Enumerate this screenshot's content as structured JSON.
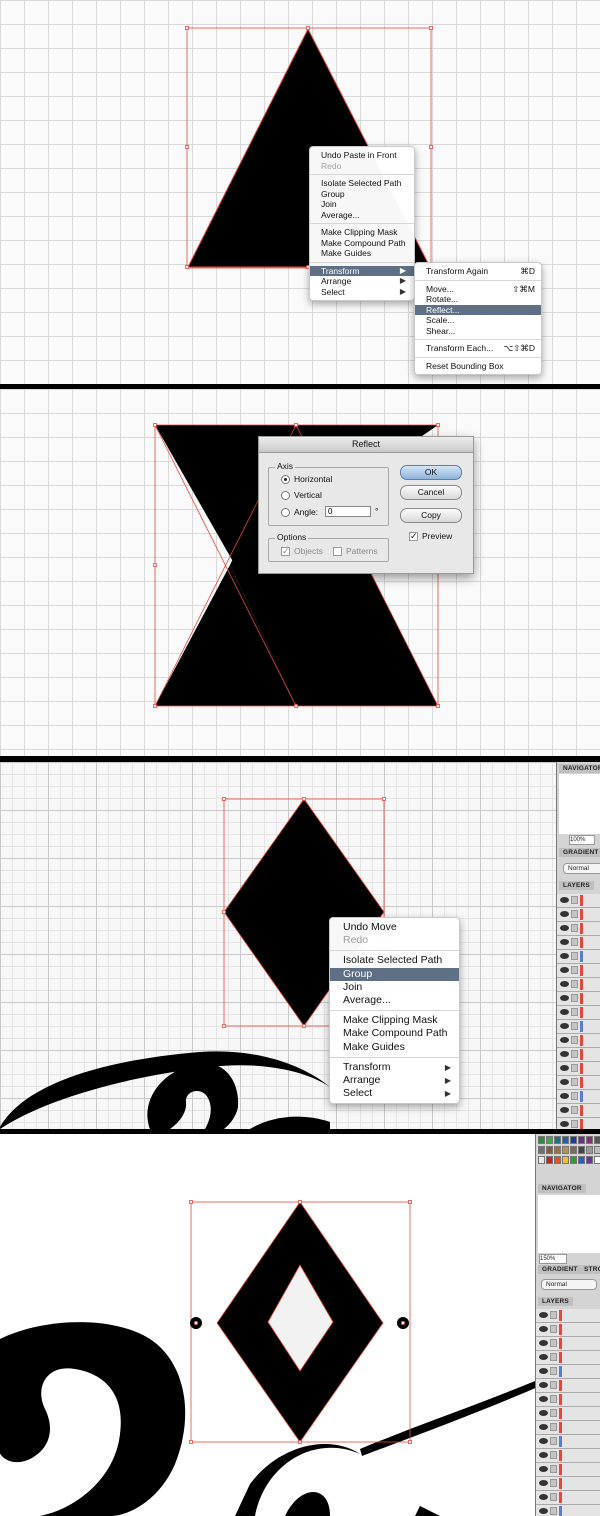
{
  "menu1": {
    "items": [
      {
        "label": "Undo Paste in Front",
        "disabled": false
      },
      {
        "label": "Redo",
        "disabled": true
      },
      {
        "divider": true
      },
      {
        "label": "Isolate Selected Path"
      },
      {
        "label": "Group"
      },
      {
        "label": "Join"
      },
      {
        "label": "Average..."
      },
      {
        "divider": true
      },
      {
        "label": "Make Clipping Mask"
      },
      {
        "label": "Make Compound Path"
      },
      {
        "label": "Make Guides"
      },
      {
        "divider": true
      },
      {
        "label": "Transform",
        "highlighted": true,
        "submenu": true
      },
      {
        "label": "Arrange",
        "submenu": true
      },
      {
        "label": "Select",
        "submenu": true
      }
    ]
  },
  "submenu": {
    "items": [
      {
        "label": "Transform Again",
        "shortcut": "⌘D"
      },
      {
        "divider": true
      },
      {
        "label": "Move...",
        "shortcut": "⇧⌘M"
      },
      {
        "label": "Rotate..."
      },
      {
        "label": "Reflect...",
        "highlighted": true
      },
      {
        "label": "Scale..."
      },
      {
        "label": "Shear..."
      },
      {
        "divider": true
      },
      {
        "label": "Transform Each...",
        "shortcut": "⌥⇧⌘D"
      },
      {
        "divider": true
      },
      {
        "label": "Reset Bounding Box"
      }
    ]
  },
  "dialog": {
    "title": "Reflect",
    "axis_label": "Axis",
    "horizontal": "Horizontal",
    "vertical": "Vertical",
    "angle_label": "Angle:",
    "angle_value": "0",
    "degree": "°",
    "options_label": "Options",
    "objects": "Objects",
    "patterns": "Patterns",
    "ok": "OK",
    "cancel": "Cancel",
    "copy": "Copy",
    "preview": "Preview"
  },
  "menu2": {
    "items": [
      {
        "label": "Undo Move"
      },
      {
        "label": "Redo",
        "disabled": true
      },
      {
        "divider": true
      },
      {
        "label": "Isolate Selected Path"
      },
      {
        "label": "Group",
        "highlighted": true
      },
      {
        "label": "Join"
      },
      {
        "label": "Average..."
      },
      {
        "divider": true
      },
      {
        "label": "Make Clipping Mask"
      },
      {
        "label": "Make Compound Path"
      },
      {
        "label": "Make Guides"
      },
      {
        "divider": true
      },
      {
        "label": "Transform",
        "submenu": true
      },
      {
        "label": "Arrange",
        "submenu": true
      },
      {
        "label": "Select",
        "submenu": true
      }
    ]
  },
  "panel3": {
    "navigator": "NAVIGATOR",
    "zoom": "100%",
    "gradient": "GRADIENT",
    "blend": "Normal",
    "layers": "LAYERS"
  },
  "panel4": {
    "navigator": "NAVIGATOR",
    "zoom": "150%",
    "gradient": "GRADIENT",
    "stroke": "STROK",
    "blend": "Normal",
    "layers": "LAYERS"
  },
  "colors": {
    "selection": "#e8463c",
    "menu_highlight": "#5f6f86",
    "artwork": "#000000"
  }
}
